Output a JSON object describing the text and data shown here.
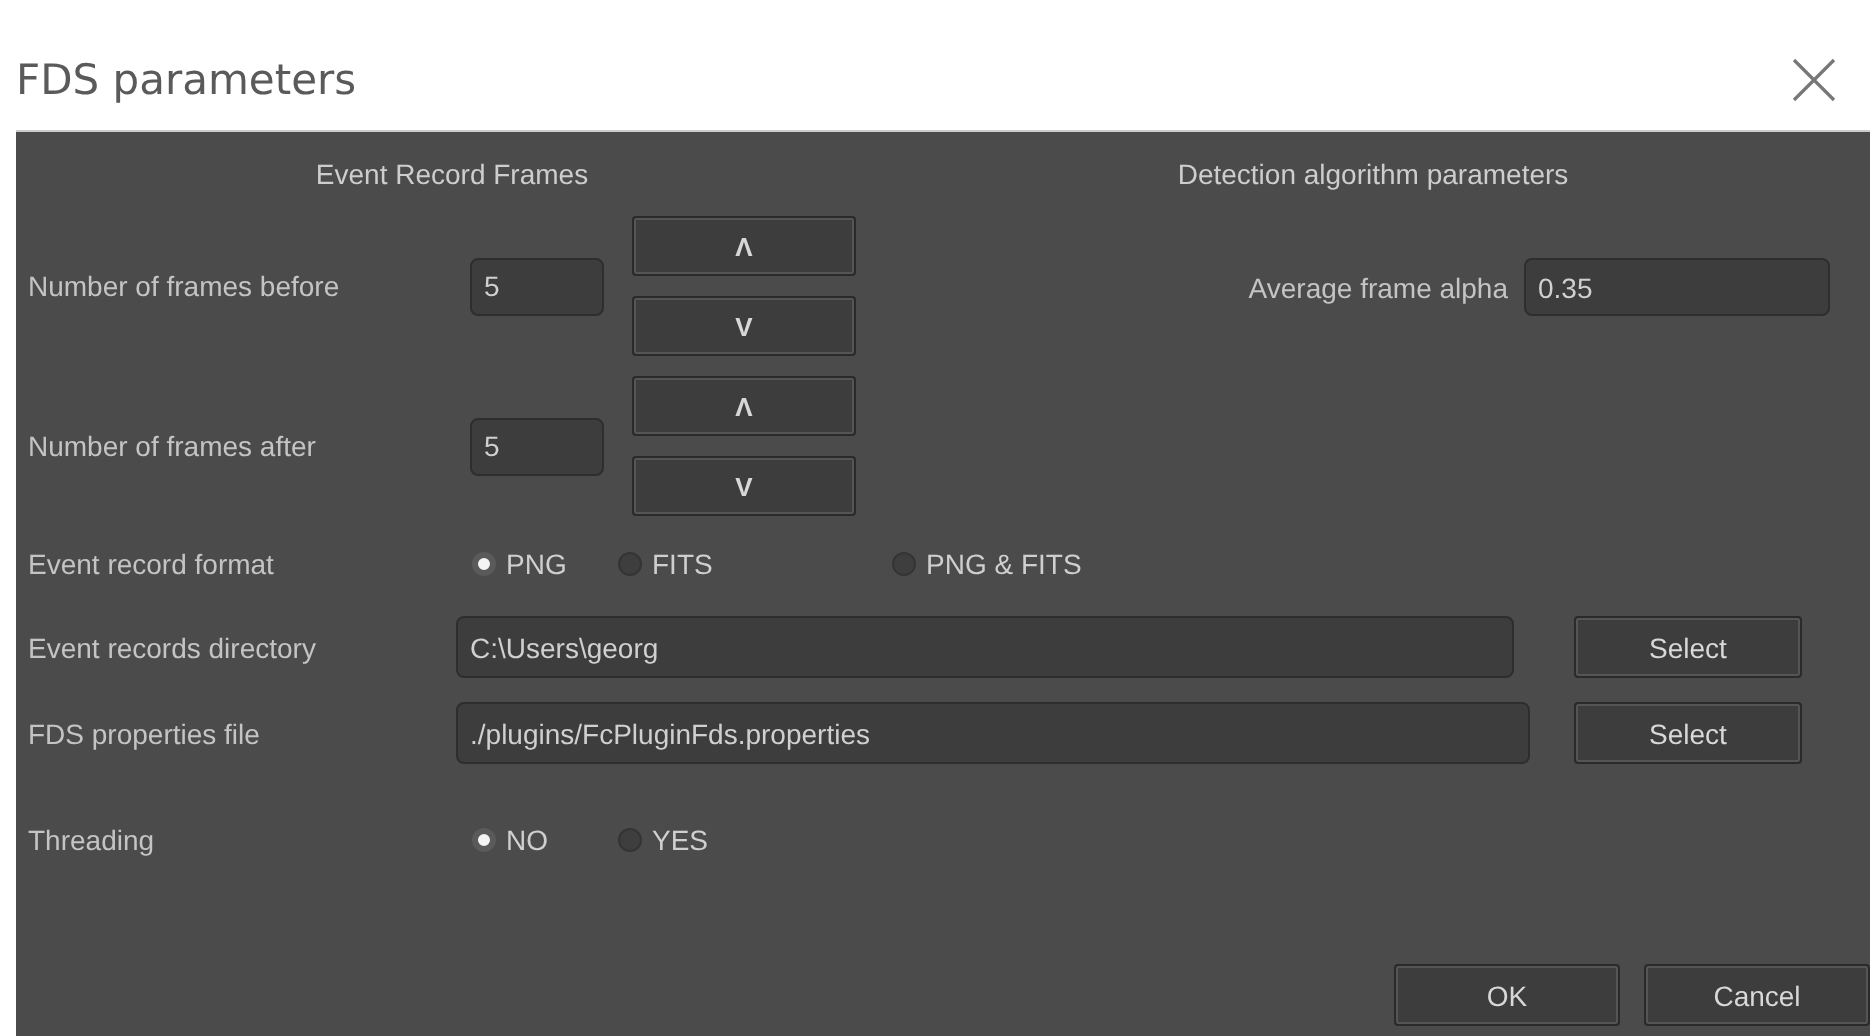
{
  "window": {
    "title": "FDS parameters"
  },
  "event_record_frames": {
    "heading": "Event Record Frames",
    "spinners": [
      {
        "label": "Number of frames before",
        "value": "5",
        "up": "Λ",
        "down": "V"
      },
      {
        "label": "Number of frames after",
        "value": "5",
        "up": "Λ",
        "down": "V"
      }
    ]
  },
  "detection": {
    "heading": "Detection algorithm parameters",
    "label": "Average frame alpha",
    "value": "0.35"
  },
  "format": {
    "label": "Event record format",
    "options": [
      {
        "label": "PNG",
        "selected": true
      },
      {
        "label": "FITS",
        "selected": false
      },
      {
        "label": "PNG & FITS",
        "selected": false
      }
    ]
  },
  "paths": [
    {
      "label": "Event records directory",
      "value": "C:\\Users\\georg",
      "button": "Select"
    },
    {
      "label": "FDS properties file",
      "value": "./plugins/FcPluginFds.properties",
      "button": "Select"
    }
  ],
  "threading": {
    "label": "Threading",
    "options": [
      {
        "label": "NO",
        "selected": true
      },
      {
        "label": "YES",
        "selected": false
      }
    ]
  },
  "buttons": [
    "OK",
    "Cancel"
  ]
}
